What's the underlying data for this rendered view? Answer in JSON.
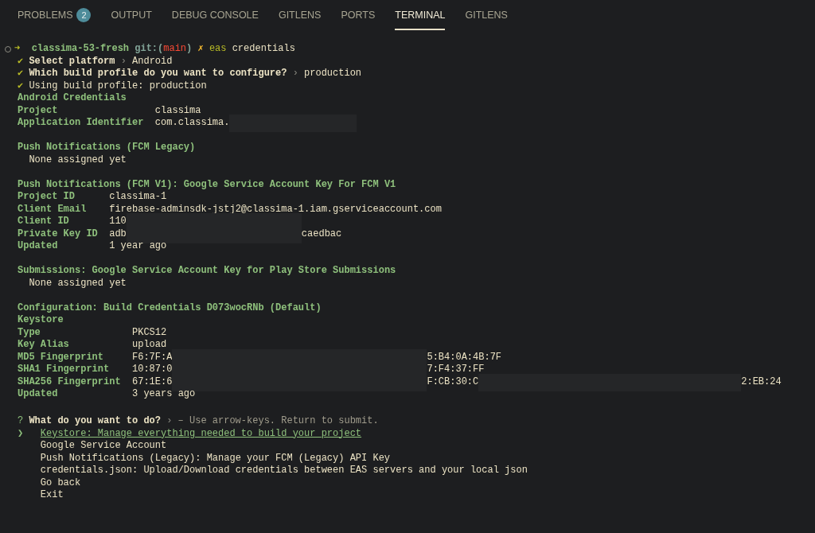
{
  "tabs": [
    {
      "label": "PROBLEMS",
      "badge": "2",
      "selected": false
    },
    {
      "label": "OUTPUT",
      "selected": false
    },
    {
      "label": "DEBUG CONSOLE",
      "selected": false
    },
    {
      "label": "GITLENS",
      "selected": false
    },
    {
      "label": "PORTS",
      "selected": false
    },
    {
      "label": "TERMINAL",
      "selected": true
    },
    {
      "label": "GITLENS",
      "selected": false
    }
  ],
  "terminal": {
    "prompt": {
      "arrow": "➜",
      "directory": "classima-53-fresh",
      "git_label": "git:(",
      "branch": "main",
      "git_close": ")",
      "dirty_mark": "✗",
      "command": "eas",
      "args": "credentials"
    },
    "lines": [
      {
        "kind": "check",
        "mark": "✔",
        "question": "Select platform",
        "sep": "›",
        "answer": "Android"
      },
      {
        "kind": "check",
        "mark": "✔",
        "question": "Which build profile do you want to configure?",
        "sep": "›",
        "answer": "production"
      },
      {
        "kind": "check",
        "mark": "✔",
        "text": "Using build profile: production"
      },
      {
        "kind": "section",
        "heading": "Android Credentials",
        "fields": [
          {
            "label": "Project",
            "segments": [
              {
                "kind": "text",
                "text": "classima"
              }
            ]
          },
          {
            "label": "Application Identifier",
            "segments": [
              {
                "kind": "text",
                "text": "com.classima."
              },
              {
                "kind": "redacted"
              }
            ]
          }
        ]
      },
      {
        "kind": "blank"
      },
      {
        "kind": "section",
        "heading": "Push Notifications (FCM Legacy)",
        "note": "None assigned yet"
      },
      {
        "kind": "blank"
      },
      {
        "kind": "section",
        "heading": "Push Notifications (FCM V1): Google Service Account Key For FCM V1",
        "fields": [
          {
            "label": "Project ID",
            "segments": [
              {
                "kind": "text",
                "text": "classima-1"
              }
            ]
          },
          {
            "label": "Client Email",
            "segments": [
              {
                "kind": "text",
                "text": "firebase-adminsdk-jstj2@classima-1.iam.gserviceaccount.com"
              }
            ]
          },
          {
            "label": "Client ID",
            "segments": [
              {
                "kind": "text",
                "text": "110"
              },
              {
                "kind": "redacted"
              }
            ]
          },
          {
            "label": "Private Key ID",
            "segments": [
              {
                "kind": "text",
                "text": "adb"
              },
              {
                "kind": "redacted"
              },
              {
                "kind": "text",
                "text": "caedbac"
              }
            ]
          },
          {
            "label": "Updated",
            "segments": [
              {
                "kind": "text",
                "text": "1 year ago"
              }
            ]
          }
        ]
      },
      {
        "kind": "blank"
      },
      {
        "kind": "section",
        "heading": "Submissions: Google Service Account Key for Play Store Submissions",
        "note": "None assigned yet"
      },
      {
        "kind": "blank"
      },
      {
        "kind": "section",
        "heading": "Configuration: Build Credentials D073wocRNb (Default)",
        "subheading": "Keystore",
        "fields": [
          {
            "label": "Type",
            "segments": [
              {
                "kind": "text",
                "text": "PKCS12"
              }
            ]
          },
          {
            "label": "Key Alias",
            "segments": [
              {
                "kind": "text",
                "text": "upload"
              }
            ]
          },
          {
            "label": "MD5 Fingerprint",
            "segments": [
              {
                "kind": "text",
                "text": "F6:7F:A"
              },
              {
                "kind": "redacted"
              },
              {
                "kind": "text",
                "text": "5:B4:0A:4B:7F"
              }
            ]
          },
          {
            "label": "SHA1 Fingerprint",
            "segments": [
              {
                "kind": "text",
                "text": "10:87:0"
              },
              {
                "kind": "redacted"
              },
              {
                "kind": "text",
                "text": "7:F4:37:FF"
              }
            ]
          },
          {
            "label": "SHA256 Fingerprint",
            "segments": [
              {
                "kind": "text",
                "text": "67:1E:6"
              },
              {
                "kind": "redacted"
              },
              {
                "kind": "text",
                "text": "F:CB:30:C"
              },
              {
                "kind": "redacted"
              },
              {
                "kind": "text",
                "text": "2:EB:24"
              }
            ]
          },
          {
            "label": "Updated",
            "segments": [
              {
                "kind": "text",
                "text": "3 years ago"
              }
            ]
          }
        ]
      },
      {
        "kind": "blank"
      },
      {
        "kind": "question",
        "mark": "?",
        "question": "What do you want to do?",
        "sep": "›",
        "hint": "– Use arrow-keys. Return to submit."
      }
    ],
    "pointer": "❯",
    "options": [
      {
        "label": "Keystore: Manage everything needed to build your project",
        "selected": true
      },
      {
        "label": "Google Service Account",
        "selected": false
      },
      {
        "label": "Push Notifications (Legacy): Manage your FCM (Legacy) API Key",
        "selected": false
      },
      {
        "label": "credentials.json: Upload/Download credentials between EAS servers and your local json",
        "selected": false
      },
      {
        "label": "Go back",
        "selected": false
      },
      {
        "label": "Exit",
        "selected": false
      }
    ]
  }
}
